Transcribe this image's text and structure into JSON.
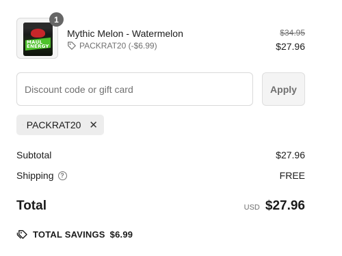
{
  "product": {
    "image_alt": "MAUL ENERGY",
    "quantity": "1",
    "name": "Mythic Melon - Watermelon",
    "discount_line": "PACKRAT20 (-$6.99)",
    "original_price": "$34.95",
    "final_price": "$27.96"
  },
  "discount": {
    "placeholder": "Discount code or gift card",
    "apply_label": "Apply",
    "applied_code": "PACKRAT20"
  },
  "summary": {
    "subtotal_label": "Subtotal",
    "subtotal_value": "$27.96",
    "shipping_label": "Shipping",
    "shipping_value": "FREE",
    "total_label": "Total",
    "currency": "USD",
    "total_value": "$27.96",
    "savings_label": "TOTAL SAVINGS",
    "savings_value": "$6.99"
  },
  "icons": {
    "tag": "tag-icon",
    "remove": "close-icon",
    "help": "question-circle-icon",
    "savings": "double-tag-icon"
  },
  "colors": {
    "muted": "#707070",
    "badge": "#666666",
    "chip_bg": "#ededed",
    "product_accent": "#4ec22c"
  }
}
